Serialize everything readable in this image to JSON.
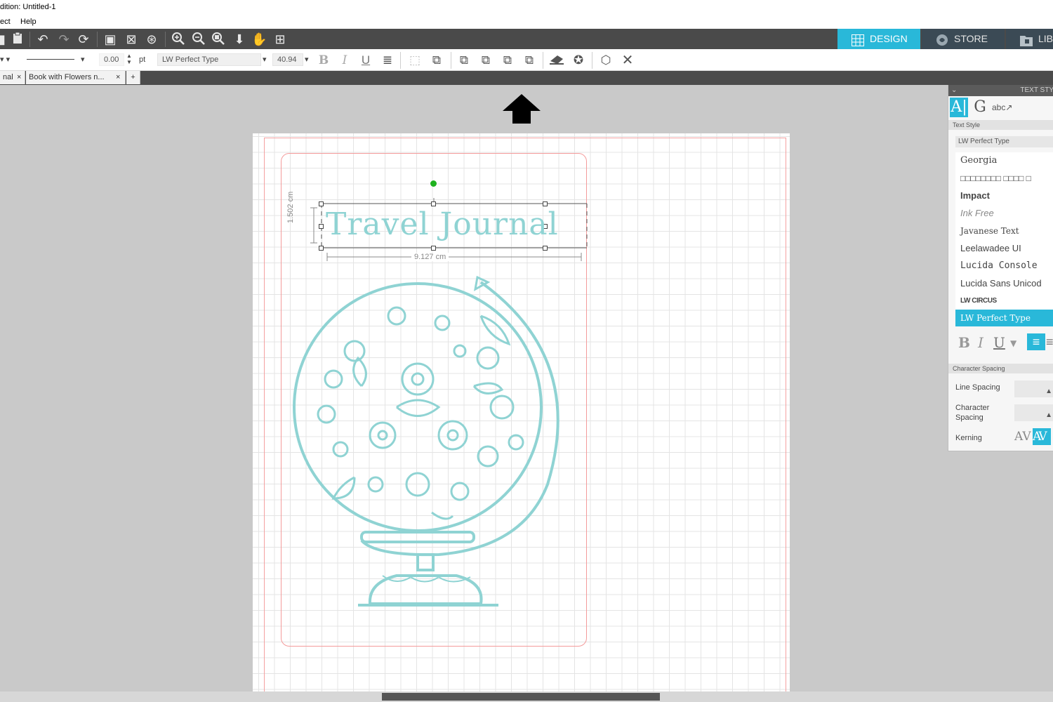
{
  "window": {
    "title": "dition: Untitled-1"
  },
  "menu": {
    "items": [
      "ect",
      "Help"
    ]
  },
  "nav_tabs": {
    "design": "DESIGN",
    "store": "STORE",
    "library": "LIB"
  },
  "toolbar2": {
    "line_weight": "0.00",
    "unit": "pt",
    "font_name": "LW Perfect Type",
    "font_size": "40.94"
  },
  "doc_tabs": {
    "tab1": "nal",
    "tab2": "Book with Flowers n..."
  },
  "canvas": {
    "text_object": "Travel Journal",
    "height_dim": "1.502 cm",
    "width_dim": "9.127 cm"
  },
  "panel": {
    "title": "TEXT STY",
    "section_text_style": "Text Style",
    "current_font": "LW Perfect Type",
    "fonts": [
      "Georgia",
      "□□□□□□□□ □□□□ □",
      "Impact",
      "Ink Free",
      "Javanese Text",
      "Leelawadee UI",
      "Lucida Console",
      "Lucida Sans Unicod",
      "LW CIRCUS",
      "LW Perfect Type"
    ],
    "section_spacing": "Character Spacing",
    "line_spacing_label": "Line Spacing",
    "char_spacing_label": "Character Spacing",
    "kerning_label": "Kerning",
    "kerning_off": "AV",
    "kerning_on": "AV"
  },
  "colors": {
    "accent": "#29b8d9",
    "artwork": "#8fd3d3",
    "cut_line": "#f4a0a0",
    "rotate": "#1fb21f"
  }
}
